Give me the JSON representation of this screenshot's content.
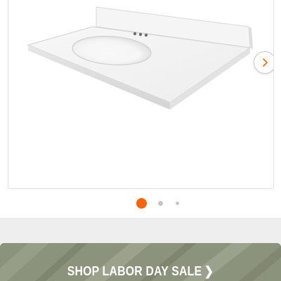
{
  "carousel": {
    "image_alt": "White cultured marble vanity top with integrated oval sink and backsplash",
    "next_icon": "chevron-right-icon",
    "dots": [
      {
        "active": true
      },
      {
        "active": false
      },
      {
        "active": false
      }
    ],
    "accent_color": "#f96302"
  },
  "promo": {
    "label": "SHOP LABOR DAY SALE",
    "chevron": "❯"
  }
}
